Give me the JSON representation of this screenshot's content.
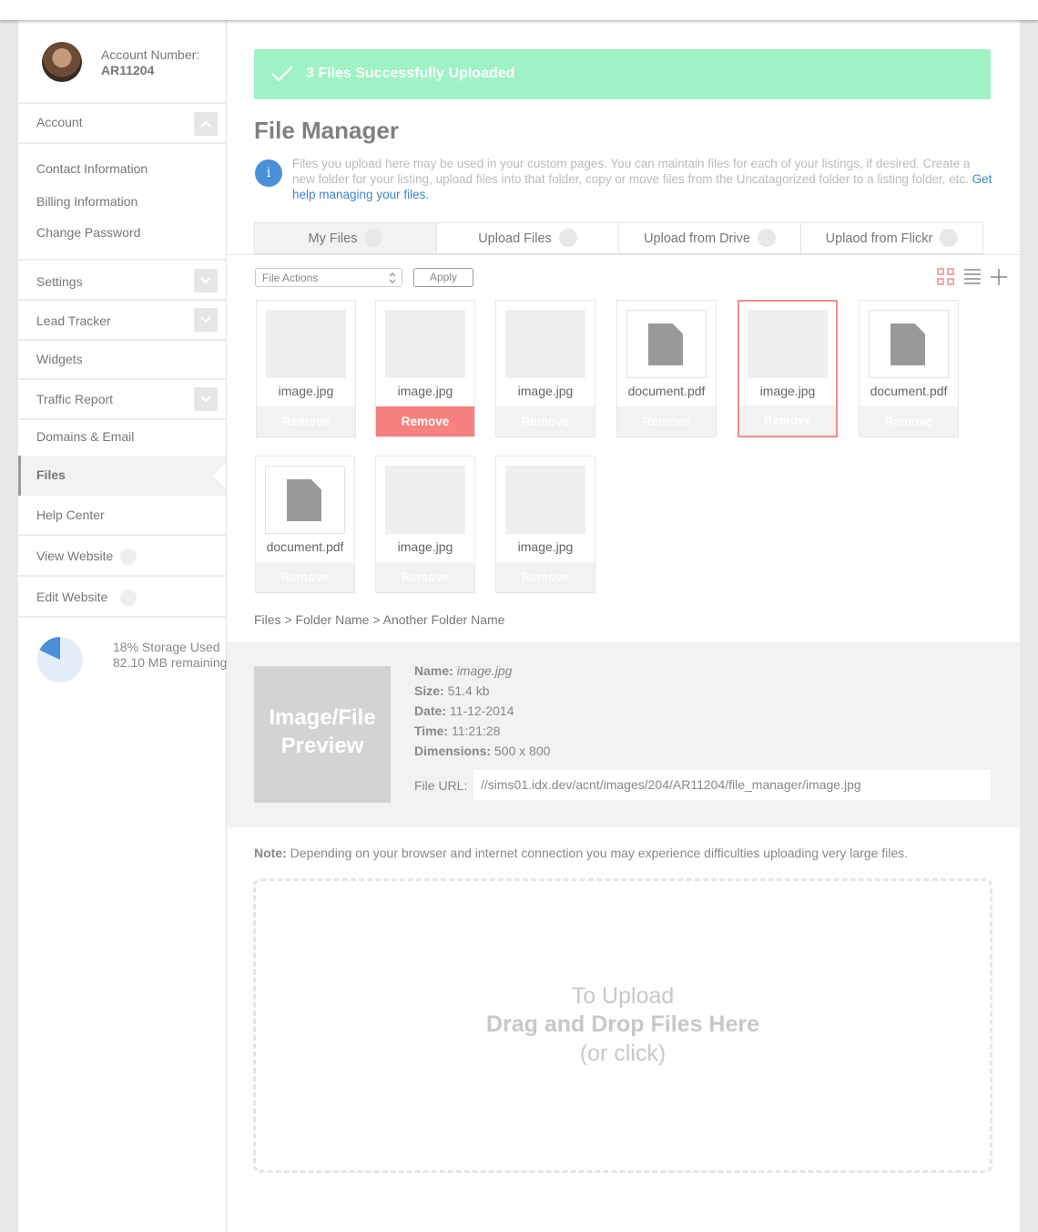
{
  "account": {
    "label": "Account Number:",
    "number": "AR11204"
  },
  "sidebar": {
    "account": "Account",
    "contact": "Contact Information",
    "billing": "Billing Information",
    "password": "Change Password",
    "settings": "Settings",
    "lead_tracker": "Lead Tracker",
    "widgets": "Widgets",
    "traffic": "Traffic Report",
    "domains": "Domains & Email",
    "files": "Files",
    "help": "Help Center",
    "view_website": "View Website",
    "edit_website": "Edit Website"
  },
  "storage": {
    "used_text": "18% Storage Used",
    "remaining_text": "82.10 MB remaining",
    "used_fraction": 0.18
  },
  "banner": {
    "text": "3 Files Successfully Uploaded"
  },
  "page_title": "File Manager",
  "info": {
    "text": "Files you upload here may be used in your custom pages. You can maintain files for each of your listings, if desired. Create a new folder for your listing, upload files into that folder, copy or move files from the Uncatagorized folder to a listing folder, etc.",
    "link": "Get help managing your files."
  },
  "tabs": [
    "My Files",
    "Upload Files",
    "Upload from Drive",
    "Uplaod from Flickr"
  ],
  "toolbar": {
    "file_actions": "File Actions",
    "apply": "Apply"
  },
  "files": [
    {
      "name": "image.jpg",
      "type": "image",
      "remove": "Remove"
    },
    {
      "name": "image.jpg",
      "type": "image",
      "remove": "Remove"
    },
    {
      "name": "image.jpg",
      "type": "image",
      "remove": "Remove"
    },
    {
      "name": "document.pdf",
      "type": "doc",
      "remove": "Remove"
    },
    {
      "name": "image.jpg",
      "type": "image",
      "remove": "Remove"
    },
    {
      "name": "document.pdf",
      "type": "doc",
      "remove": "Remove"
    },
    {
      "name": "document.pdf",
      "type": "doc",
      "remove": "Remove"
    },
    {
      "name": "image.jpg",
      "type": "image",
      "remove": "Remove"
    },
    {
      "name": "image.jpg",
      "type": "image",
      "remove": "Remove"
    }
  ],
  "breadcrumb": "Files > Folder Name > Another Folder Name",
  "detail": {
    "preview_line1": "Image/File",
    "preview_line2": "Preview",
    "name_label": "Name:",
    "name": "image.jpg",
    "size_label": "Size:",
    "size": "51.4 kb",
    "date_label": "Date:",
    "date": "11-12-2014",
    "time_label": "Time:",
    "time": "11:21:28",
    "dims_label": "Dimensions:",
    "dims": "500 x 800",
    "url_label": "File URL:",
    "url": "//sims01.idx.dev/acnt/images/204/AR11204/file_manager/image.jpg"
  },
  "note": {
    "label": "Note:",
    "text": "Depending on your browser and internet connection you may experience difficulties uploading very large files."
  },
  "dropzone": {
    "line1": "To Upload",
    "line2": "Drag and Drop Files Here",
    "line3": "(or click)"
  },
  "colors": {
    "banner": "#9ff2c3",
    "remove_active": "#f78080",
    "selected_border": "#f28b8b",
    "link": "#3b87d1",
    "storage_used": "#4a90d9"
  }
}
